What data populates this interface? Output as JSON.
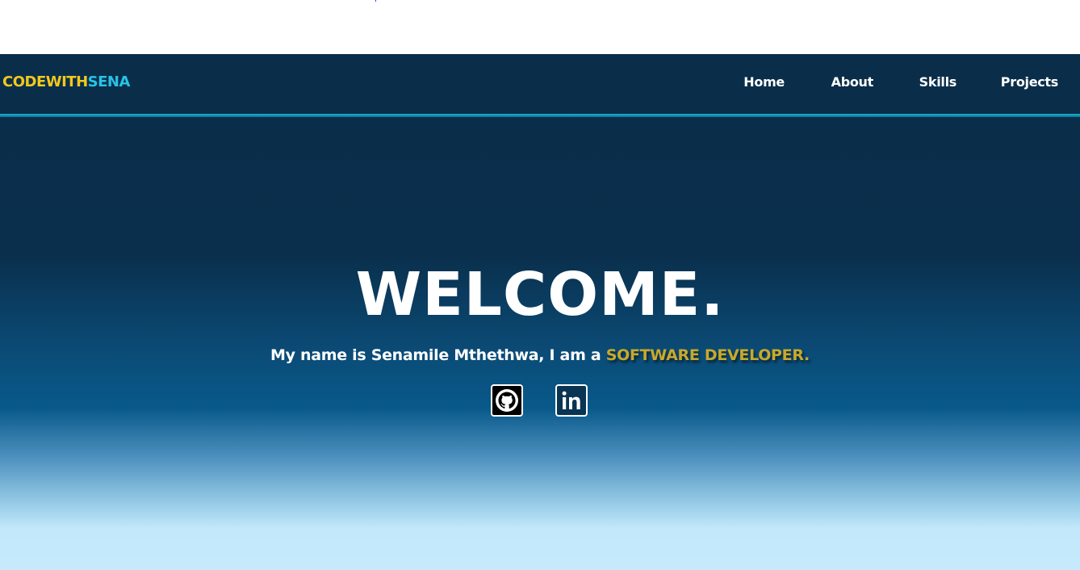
{
  "brand": {
    "part1": "CODEWITH",
    "part2": "SENA"
  },
  "nav": {
    "items": [
      {
        "label": "Home"
      },
      {
        "label": "About"
      },
      {
        "label": "Skills"
      },
      {
        "label": "Projects"
      }
    ]
  },
  "hero": {
    "title": "WELCOME.",
    "intro": "My name is Senamile Mthethwa, I am a ",
    "role": "SOFTWARE DEVELOPER."
  },
  "social": {
    "github_icon": "github-icon",
    "linkedin_icon": "linkedin-icon"
  },
  "colors": {
    "navbar": "#0a2e4a",
    "brand_primary": "#f2c81d",
    "brand_secondary": "#27c3e6",
    "role_highlight": "#c9a92b",
    "nav_underline": "#1bb3d6"
  }
}
